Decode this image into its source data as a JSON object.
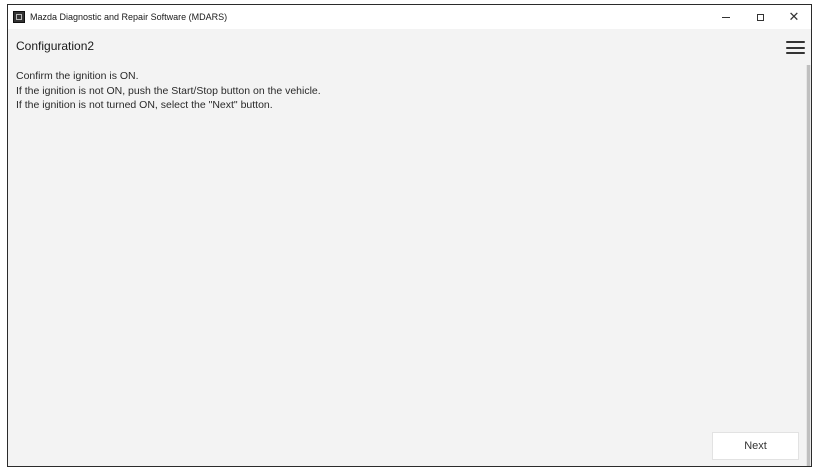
{
  "window": {
    "title": "Mazda Diagnostic and Repair Software (MDARS)",
    "icon": "mdars-app-icon",
    "controls": {
      "minimize_icon": "minimize-icon",
      "maximize_icon": "maximize-icon",
      "close_label": "✕"
    }
  },
  "header": {
    "title": "Configuration2",
    "menu_icon": "hamburger-menu-icon"
  },
  "main": {
    "instructions": [
      "Confirm the ignition is ON.",
      "If the ignition is not ON, push the Start/Stop button on the vehicle.",
      "If the ignition is not turned ON, select the \"Next\" button."
    ]
  },
  "footer": {
    "next_label": "Next"
  },
  "colors": {
    "window_background": "#f3f3f3",
    "titlebar_background": "#ffffff",
    "button_background": "#ffffff",
    "text": "#2a2a2a"
  }
}
